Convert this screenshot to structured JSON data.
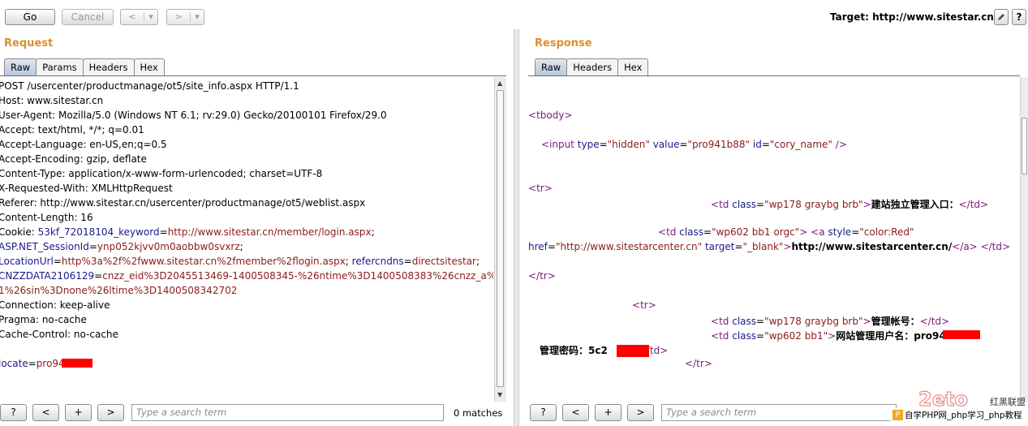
{
  "toolbar": {
    "go": "Go",
    "cancel": "Cancel",
    "back": "<",
    "forward": ">",
    "dropdown": "▾",
    "target_label": "Target: http://www.sitestar.cn"
  },
  "request": {
    "title": "Request",
    "tabs": [
      "Raw",
      "Params",
      "Headers",
      "Hex"
    ],
    "lines": [
      "POST /usercenter/productmanage/ot5/site_info.aspx HTTP/1.1",
      "Host: www.sitestar.cn",
      "User-Agent: Mozilla/5.0 (Windows NT 6.1; rv:29.0) Gecko/20100101 Firefox/29.0",
      "Accept: text/html, */*; q=0.01",
      "Accept-Language: en-US,en;q=0.5",
      "Accept-Encoding: gzip, deflate",
      "Content-Type: application/x-www-form-urlencoded; charset=UTF-8",
      "X-Requested-With: XMLHttpRequest",
      "Referer: http://www.sitestar.cn/usercenter/productmanage/ot5/weblist.aspx",
      "Content-Length: 16"
    ],
    "cookie": {
      "label": "Cookie: ",
      "k1": "53kf_72018104_keyword",
      "v1": "http://www.sitestar.cn/member/login.aspx",
      "k2": "ASP.NET_SessionId",
      "v2": "ynp052kjvv0m0aobbw0svxrz",
      "k3": "LocationUrl",
      "v3": "http%3a%2f%2fwww.sitestar.cn%2fmember%2flogin.aspx",
      "k4": "refercndns",
      "v4": "directsitestar",
      "k5": "CNZZDATA2106129",
      "v5a": "cnzz_eid%3D2045513469-1400508345-%26ntime%3D1400508383%26cnzz_a%3D",
      "v5b": "1%26sin%3Dnone%26ltime%3D1400508342702"
    },
    "tail_lines": [
      "Connection: keep-alive",
      "Pragma: no-cache",
      "Cache-Control: no-cache"
    ],
    "body_key": "locate",
    "body_value": "pro94"
  },
  "response": {
    "title": "Response",
    "tabs": [
      "Raw",
      "Headers",
      "Hex"
    ],
    "tbody": "tbody",
    "input_tag": "input",
    "input_type": "hidden",
    "input_value": "pro941b88",
    "input_id": "cory_name",
    "tr": "tr",
    "td": "td",
    "td_class1": "wp178 graybg brb",
    "td_text1": "建站独立管理入口：",
    "td_class2": "wp602 bb1 orgc",
    "a_style": "color:Red",
    "href": "http://www.sitestarcenter.cn",
    "target": "_blank",
    "link_text": "http://www.sitestarcenter.cn/",
    "td_class3": "wp178 graybg brb",
    "td_text3": "管理帐号：",
    "td_class4": "wp602 bb1",
    "td_text4": "网站管理用户名：pro94",
    "pwd_text": "管理密码：5c2"
  },
  "bottom_left": {
    "help": "?",
    "prev": "<",
    "add": "+",
    "next": ">",
    "search_placeholder": "Type a search term",
    "matches": "0 matches"
  },
  "bottom_right": {
    "help": "?",
    "prev": "<",
    "add": "+",
    "next": ">",
    "search_placeholder": "Type a search term"
  },
  "watermark": {
    "text1": "红黑联盟",
    "text2": "自学PHP网_php学习_php教程"
  },
  "colors": {
    "accent_title": "#d9902a",
    "redaction": "#ff0000"
  }
}
